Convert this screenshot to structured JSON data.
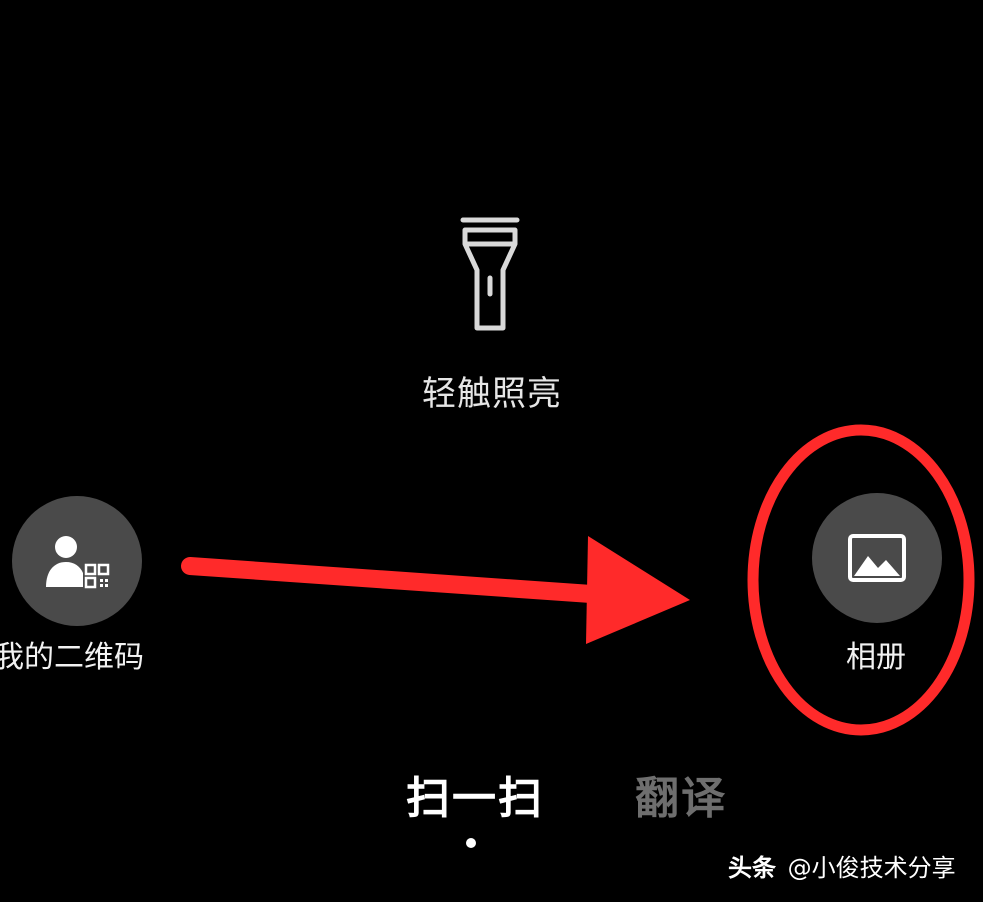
{
  "flashlight": {
    "icon": "flashlight-icon",
    "label": "轻触照亮"
  },
  "my_qr_code": {
    "icon": "person-qr-icon",
    "label": "我的二维码"
  },
  "album": {
    "icon": "image-icon",
    "label": "相册"
  },
  "mode_tabs": [
    {
      "label": "扫一扫",
      "active": true
    },
    {
      "label": "翻译",
      "active": false
    }
  ],
  "watermark": {
    "brand": "头条",
    "author": "@小俊技术分享"
  },
  "annotation": {
    "color": "#ff2a2a",
    "shapes": [
      "arrow",
      "ellipse"
    ]
  },
  "colors": {
    "background": "#000000",
    "button_bg": "#4a4a4a",
    "active_tab": "#ffffff",
    "inactive_tab": "#6e6e6e"
  }
}
